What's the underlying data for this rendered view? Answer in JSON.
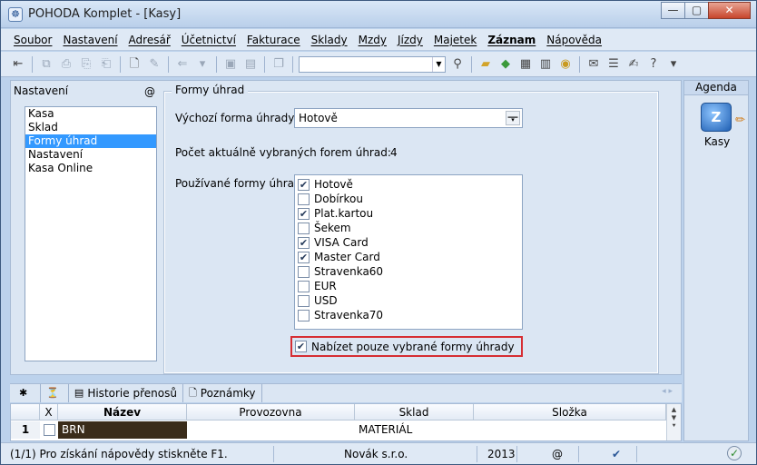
{
  "window": {
    "title": "POHODA Komplet - [Kasy]",
    "min_label": "—",
    "max_label": "▢",
    "close_label": "✕"
  },
  "menu": [
    {
      "label": "Soubor"
    },
    {
      "label": "Nastavení"
    },
    {
      "label": "Adresář"
    },
    {
      "label": "Účetnictví"
    },
    {
      "label": "Fakturace"
    },
    {
      "label": "Sklady"
    },
    {
      "label": "Mzdy"
    },
    {
      "label": "Jízdy"
    },
    {
      "label": "Majetek"
    },
    {
      "label": "Záznam",
      "bold": true
    },
    {
      "label": "Nápověda"
    }
  ],
  "toolbar": {
    "search_value": ""
  },
  "left_panel": {
    "title": "Nastavení",
    "at": "@",
    "items": [
      {
        "label": "Kasa"
      },
      {
        "label": "Sklad"
      },
      {
        "label": "Formy úhrad",
        "selected": true
      },
      {
        "label": "Nastavení"
      },
      {
        "label": "Kasa Online"
      }
    ]
  },
  "form": {
    "group_title": "Formy úhrad",
    "default_label": "Výchozí forma úhrady",
    "default_value": "Hotově",
    "count_label": "Počet aktuálně vybraných forem úhrad:",
    "count_value": "4",
    "used_label": "Používané formy úhrad",
    "payments": [
      {
        "label": "Hotově",
        "checked": true
      },
      {
        "label": "Dobírkou",
        "checked": false
      },
      {
        "label": "Plat.kartou",
        "checked": true
      },
      {
        "label": "Šekem",
        "checked": false
      },
      {
        "label": "VISA Card",
        "checked": true
      },
      {
        "label": "Master Card",
        "checked": true
      },
      {
        "label": "Stravenka60",
        "checked": false
      },
      {
        "label": "EUR",
        "checked": false
      },
      {
        "label": "USD",
        "checked": false
      },
      {
        "label": "Stravenka70",
        "checked": false
      }
    ],
    "offer_only_label": "Nabízet pouze vybrané formy úhrady",
    "offer_only_checked": true,
    "highlight_color": "#d62e33"
  },
  "agenda": {
    "title": "Agenda",
    "item_label": "Kasy",
    "item_icon_glyph": "Z"
  },
  "tabs": [
    {
      "label": "",
      "icon": "✱"
    },
    {
      "label": "",
      "icon": "⏳"
    },
    {
      "label": "Historie přenosů",
      "icon": "▤"
    },
    {
      "label": "Poznámky",
      "icon": "🗋"
    }
  ],
  "tab_nav": "◂ ▸",
  "grid": {
    "columns": [
      "X",
      "Název",
      "Provozovna",
      "Sklad",
      "Složka"
    ],
    "rows": [
      {
        "num": "1",
        "checked": false,
        "nazev": "BRN",
        "provozovna": "",
        "sklad": "MATERIÁL",
        "slozka": ""
      }
    ]
  },
  "status": {
    "help": "(1/1) Pro získání nápovědy stiskněte F1.",
    "company": "Novák s.r.o.",
    "year": "2013",
    "at": "@"
  }
}
